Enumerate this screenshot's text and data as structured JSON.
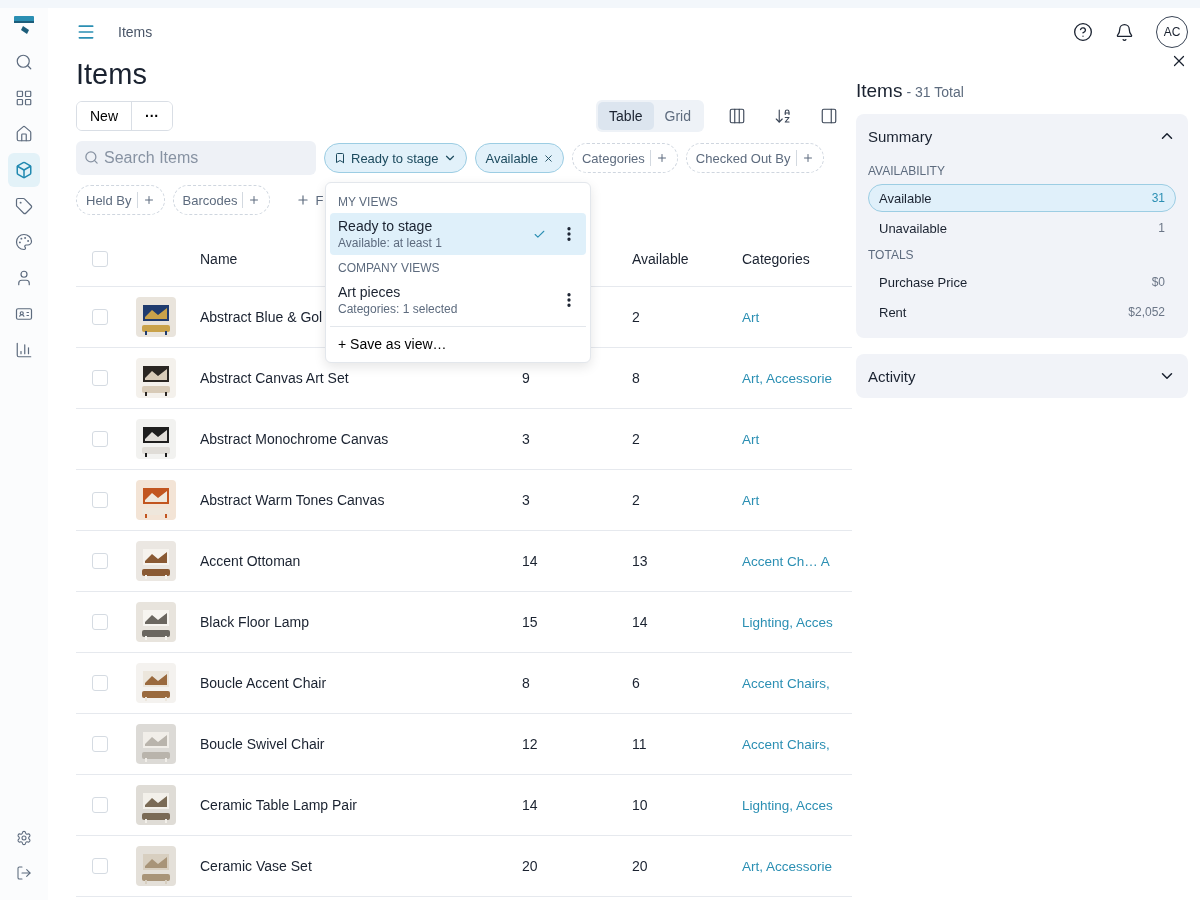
{
  "sidebar": {
    "items": [
      {
        "selected": false
      },
      {
        "selected": false
      },
      {
        "selected": false
      },
      {
        "selected": true
      },
      {
        "selected": false
      },
      {
        "selected": false
      },
      {
        "selected": false
      },
      {
        "selected": false
      },
      {
        "selected": false
      }
    ],
    "bottom": [
      {
        "selected": false
      },
      {
        "selected": false
      }
    ]
  },
  "breadcrumb": "Items",
  "avatar": "AC",
  "title": "Items",
  "toolbar": {
    "new": "New",
    "more": "···",
    "views": [
      {
        "label": "Table",
        "selected": true
      },
      {
        "label": "Grid",
        "selected": false
      }
    ]
  },
  "search": {
    "placeholder": "Search Items"
  },
  "filters": [
    {
      "kind": "view",
      "label": "Ready to stage"
    },
    {
      "kind": "active",
      "label": "Available"
    },
    {
      "kind": "add",
      "label": "Categories"
    },
    {
      "kind": "add",
      "label": "Checked Out By"
    },
    {
      "kind": "add",
      "label": "Held By"
    },
    {
      "kind": "add",
      "label": "Barcodes"
    },
    {
      "kind": "more",
      "label": "F"
    }
  ],
  "dropdown": {
    "sections": [
      {
        "heading": "MY VIEWS",
        "views": [
          {
            "name": "Ready to stage",
            "detail": "Available: at least 1",
            "selected": true
          }
        ]
      },
      {
        "heading": "COMPANY VIEWS",
        "views": [
          {
            "name": "Art pieces",
            "detail": "Categories: 1 selected",
            "selected": false
          }
        ]
      }
    ],
    "save": "+ Save as view…"
  },
  "table": {
    "columns": [
      "Name",
      "Available",
      "Categories"
    ],
    "all_checked": false,
    "rows": [
      {
        "name": "Abstract Blue & Gol",
        "available": "2",
        "categories": "Art",
        "checked": false
      },
      {
        "name": "Abstract Canvas Art Set",
        "quantity": "9",
        "available": "8",
        "categories": "Art, Accessorie",
        "checked": false
      },
      {
        "name": "Abstract Monochrome Canvas",
        "quantity": "3",
        "available": "2",
        "categories": "Art",
        "checked": false
      },
      {
        "name": "Abstract Warm Tones Canvas",
        "quantity": "3",
        "available": "2",
        "categories": "Art",
        "checked": false
      },
      {
        "name": "Accent Ottoman",
        "quantity": "14",
        "available": "13",
        "categories": "Accent Ch… A",
        "checked": false
      },
      {
        "name": "Black Floor Lamp",
        "quantity": "15",
        "available": "14",
        "categories": "Lighting, Acces",
        "checked": false
      },
      {
        "name": "Boucle Accent Chair",
        "quantity": "8",
        "available": "6",
        "categories": "Accent Chairs,",
        "checked": false
      },
      {
        "name": "Boucle Swivel Chair",
        "quantity": "12",
        "available": "11",
        "categories": "Accent Chairs,",
        "checked": false
      },
      {
        "name": "Ceramic Table Lamp Pair",
        "quantity": "14",
        "available": "10",
        "categories": "Lighting, Acces",
        "checked": false
      },
      {
        "name": "Ceramic Vase Set",
        "quantity": "20",
        "available": "20",
        "categories": "Art, Accessorie",
        "checked": false
      }
    ]
  },
  "panel": {
    "title": "Items",
    "total": "- 31 Total",
    "summary": {
      "title": "Summary",
      "expanded": true,
      "groups": [
        {
          "heading": "AVAILABILITY",
          "rows": [
            {
              "label": "Available",
              "value": "31",
              "selected": true
            },
            {
              "label": "Unavailable",
              "value": "1",
              "selected": false
            }
          ]
        },
        {
          "heading": "TOTALS",
          "rows": [
            {
              "label": "Purchase Price",
              "value": "$0",
              "selected": false
            },
            {
              "label": "Rent",
              "value": "$2,052",
              "selected": false
            }
          ]
        }
      ]
    },
    "activity": {
      "title": "Activity",
      "expanded": false
    }
  }
}
